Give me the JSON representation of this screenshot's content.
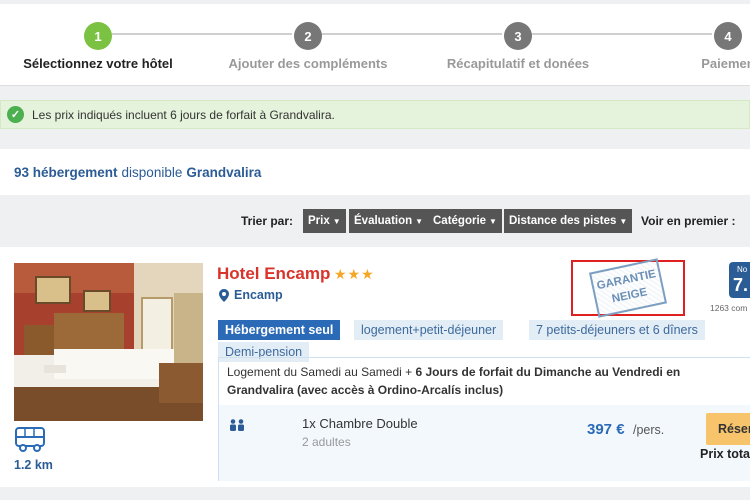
{
  "stepper": {
    "steps": [
      {
        "number": "1",
        "label": "Sélectionnez votre hôtel",
        "active": true
      },
      {
        "number": "2",
        "label": "Ajouter des compléments",
        "active": false
      },
      {
        "number": "3",
        "label": "Récapitulatif et donées",
        "active": false
      },
      {
        "number": "4",
        "label": "Paiemen",
        "active": false
      }
    ]
  },
  "info_bar": {
    "icon": "check-circle-icon",
    "text": "Les prix indiqués incluent 6 jours de forfait à Grandvalira."
  },
  "results": {
    "count": "93 hébergement",
    "middle": "disponible",
    "place": "Grandvalira"
  },
  "sort": {
    "label": "Trier par:",
    "options": [
      "Prix",
      "Évaluation",
      "Catégorie",
      "Distance des pistes"
    ],
    "see_first": "Voir en premier :"
  },
  "hotel": {
    "name": "Hotel Encamp",
    "stars": "★★★",
    "location": "Encamp",
    "distance": "1.2 km",
    "stamp_line1": "GARANTIE",
    "stamp_line2": "NEIGE",
    "rating_label": "No",
    "rating_score": "7.",
    "reviews": "1263 com",
    "board_options": [
      {
        "label": "Hébergement seul",
        "active": true
      },
      {
        "label": "logement+petit-déjeuner",
        "active": false
      },
      {
        "label": "7 petits-déjeuners et 6 dîners",
        "active": false
      },
      {
        "label": "Demi-pension",
        "active": false
      }
    ],
    "description_plain": "Logement du Samedi au Samedi + ",
    "description_bold": "6 Jours de forfait du Dimanche au Vendredi en Grandvalira (avec accès à Ordino-Arcalís inclus)",
    "room": {
      "name": "1x Chambre Double",
      "adults": "2 adultes",
      "price": "397 €",
      "per": "/pers.",
      "book_label": "Résen",
      "total_label": "Prix tota"
    }
  },
  "colors": {
    "accent": "#2b6ab7",
    "active_step": "#7cc242",
    "hotel_name": "#d9342b",
    "book_button": "#f7c36b"
  }
}
